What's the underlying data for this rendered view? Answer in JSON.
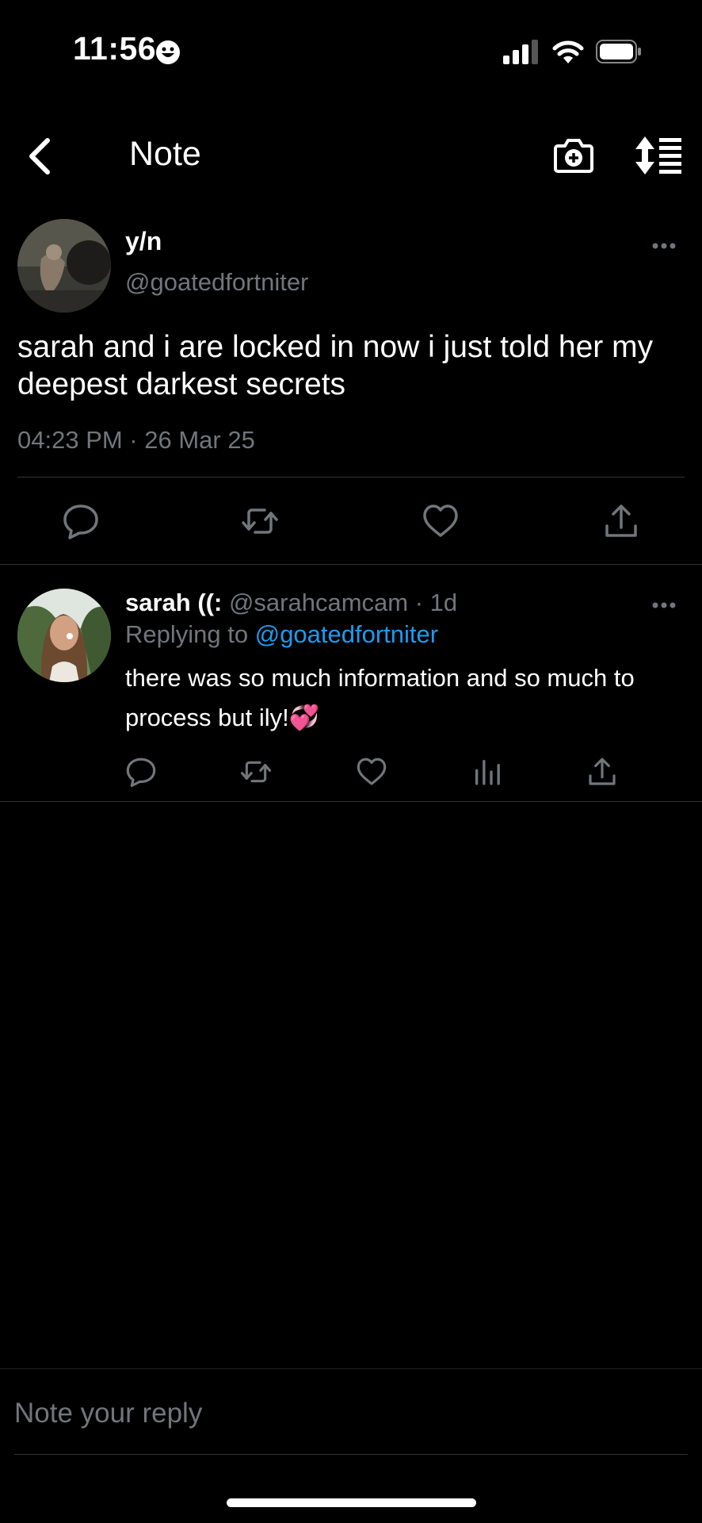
{
  "status_bar": {
    "time": "11:56"
  },
  "header": {
    "title": "Note"
  },
  "post": {
    "author_name": "y/n",
    "author_handle": "@goatedfortniter",
    "text": "sarah and i are locked in now i just told her my deepest darkest secrets",
    "timestamp": "04:23 PM · 26 Mar 25"
  },
  "reply": {
    "author_name": "sarah ((:",
    "author_handle": "@sarahcamcam · 1d",
    "replying_prefix": "Replying to",
    "replying_handle": "@goatedfortniter",
    "text": "there was so much information and so much to process but ily!💞"
  },
  "composer": {
    "placeholder": "Note your reply"
  },
  "colors": {
    "background": "#000000",
    "muted": "#71767b",
    "link": "#1d9bf0",
    "divider": "#2f3336"
  },
  "icons": [
    "smiley-icon",
    "signal-icon",
    "wifi-icon",
    "battery-icon",
    "back-arrow-icon",
    "camera-plus-icon",
    "sort-icon",
    "more-icon",
    "reply-icon",
    "retweet-icon",
    "like-icon",
    "share-icon",
    "views-icon"
  ]
}
